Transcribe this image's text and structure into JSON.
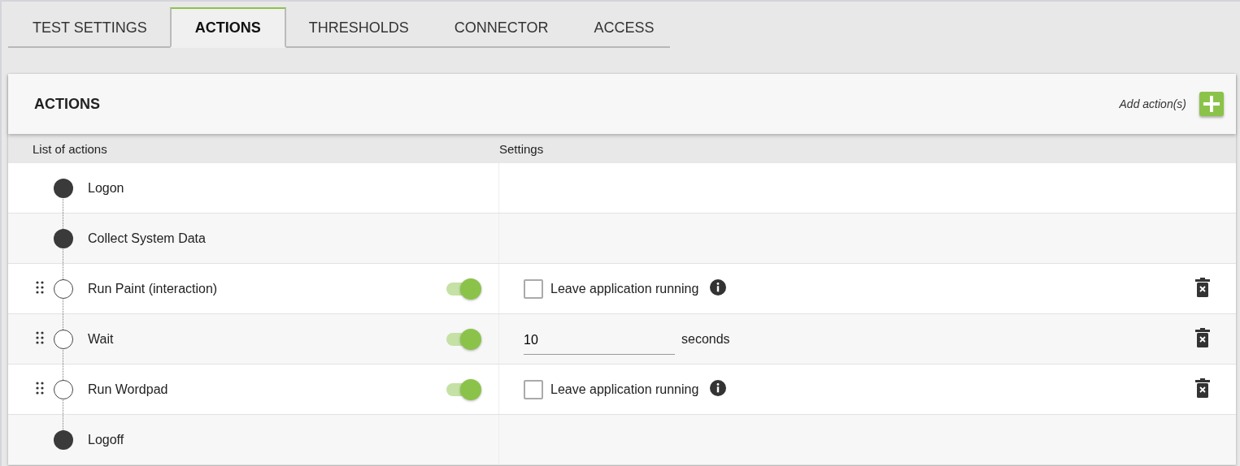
{
  "tabs": [
    {
      "label": "TEST SETTINGS",
      "selected": false
    },
    {
      "label": "ACTIONS",
      "selected": true
    },
    {
      "label": "THRESHOLDS",
      "selected": false
    },
    {
      "label": "CONNECTOR",
      "selected": false
    },
    {
      "label": "ACCESS",
      "selected": false
    }
  ],
  "panel": {
    "title": "ACTIONS",
    "add_label": "Add action(s)"
  },
  "columns": [
    "List of actions",
    "Settings"
  ],
  "actions": [
    {
      "name": "Logon",
      "kind": "fixed"
    },
    {
      "name": "Collect System Data",
      "kind": "fixed"
    },
    {
      "name": "Run Paint (interaction)",
      "kind": "custom",
      "on": true,
      "setting": {
        "kind": "checkbox",
        "label": "Leave application running",
        "checked": false
      }
    },
    {
      "name": "Wait",
      "kind": "custom",
      "on": true,
      "setting": {
        "kind": "number",
        "value": "10",
        "unit": "seconds"
      }
    },
    {
      "name": "Run Wordpad",
      "kind": "custom",
      "on": true,
      "setting": {
        "kind": "checkbox",
        "label": "Leave application running",
        "checked": false
      }
    },
    {
      "name": "Logoff",
      "kind": "fixed"
    }
  ]
}
